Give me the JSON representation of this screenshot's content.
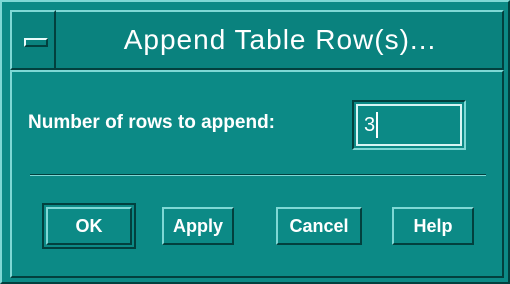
{
  "window": {
    "title": "Append Table Row(s)...",
    "menu_icon": "window-menu-icon"
  },
  "form": {
    "rows_label": "Number of rows to append:",
    "rows_value": "3"
  },
  "buttons": {
    "ok": "OK",
    "apply": "Apply",
    "cancel": "Cancel",
    "help": "Help"
  },
  "colors": {
    "background": "#0c8a86",
    "text": "#ffffff"
  }
}
